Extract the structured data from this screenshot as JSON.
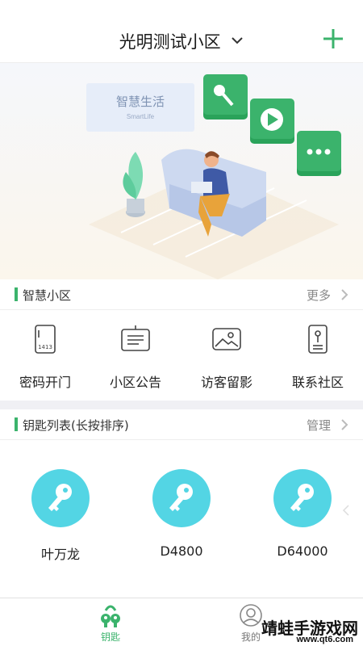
{
  "header": {
    "title": "光明测试小区",
    "add_icon": "plus-icon",
    "accent": "#3bb36c"
  },
  "banner": {
    "card_title": "智慧生活",
    "card_subtitle": "SmartLife"
  },
  "smart_section": {
    "title": "智慧小区",
    "more_label": "更多",
    "items": [
      {
        "label": "密码开门",
        "icon": "keypad-icon",
        "code": "1413"
      },
      {
        "label": "小区公告",
        "icon": "notice-board-icon"
      },
      {
        "label": "访客留影",
        "icon": "photo-icon"
      },
      {
        "label": "联系社区",
        "icon": "phone-contact-icon"
      }
    ]
  },
  "keys_section": {
    "title": "钥匙列表(长按排序)",
    "manage_label": "管理",
    "keys": [
      {
        "name": "叶万龙"
      },
      {
        "name": "D4800"
      },
      {
        "name": "D64000"
      }
    ],
    "key_color": "#53d5e4"
  },
  "tabbar": {
    "tabs": [
      {
        "label": "钥匙",
        "icon": "keys-icon",
        "active": true
      },
      {
        "label": "我的",
        "icon": "user-icon",
        "active": false
      }
    ]
  },
  "watermark": {
    "text": "靖蛙手游戏网",
    "url": "www.qt6.com"
  }
}
